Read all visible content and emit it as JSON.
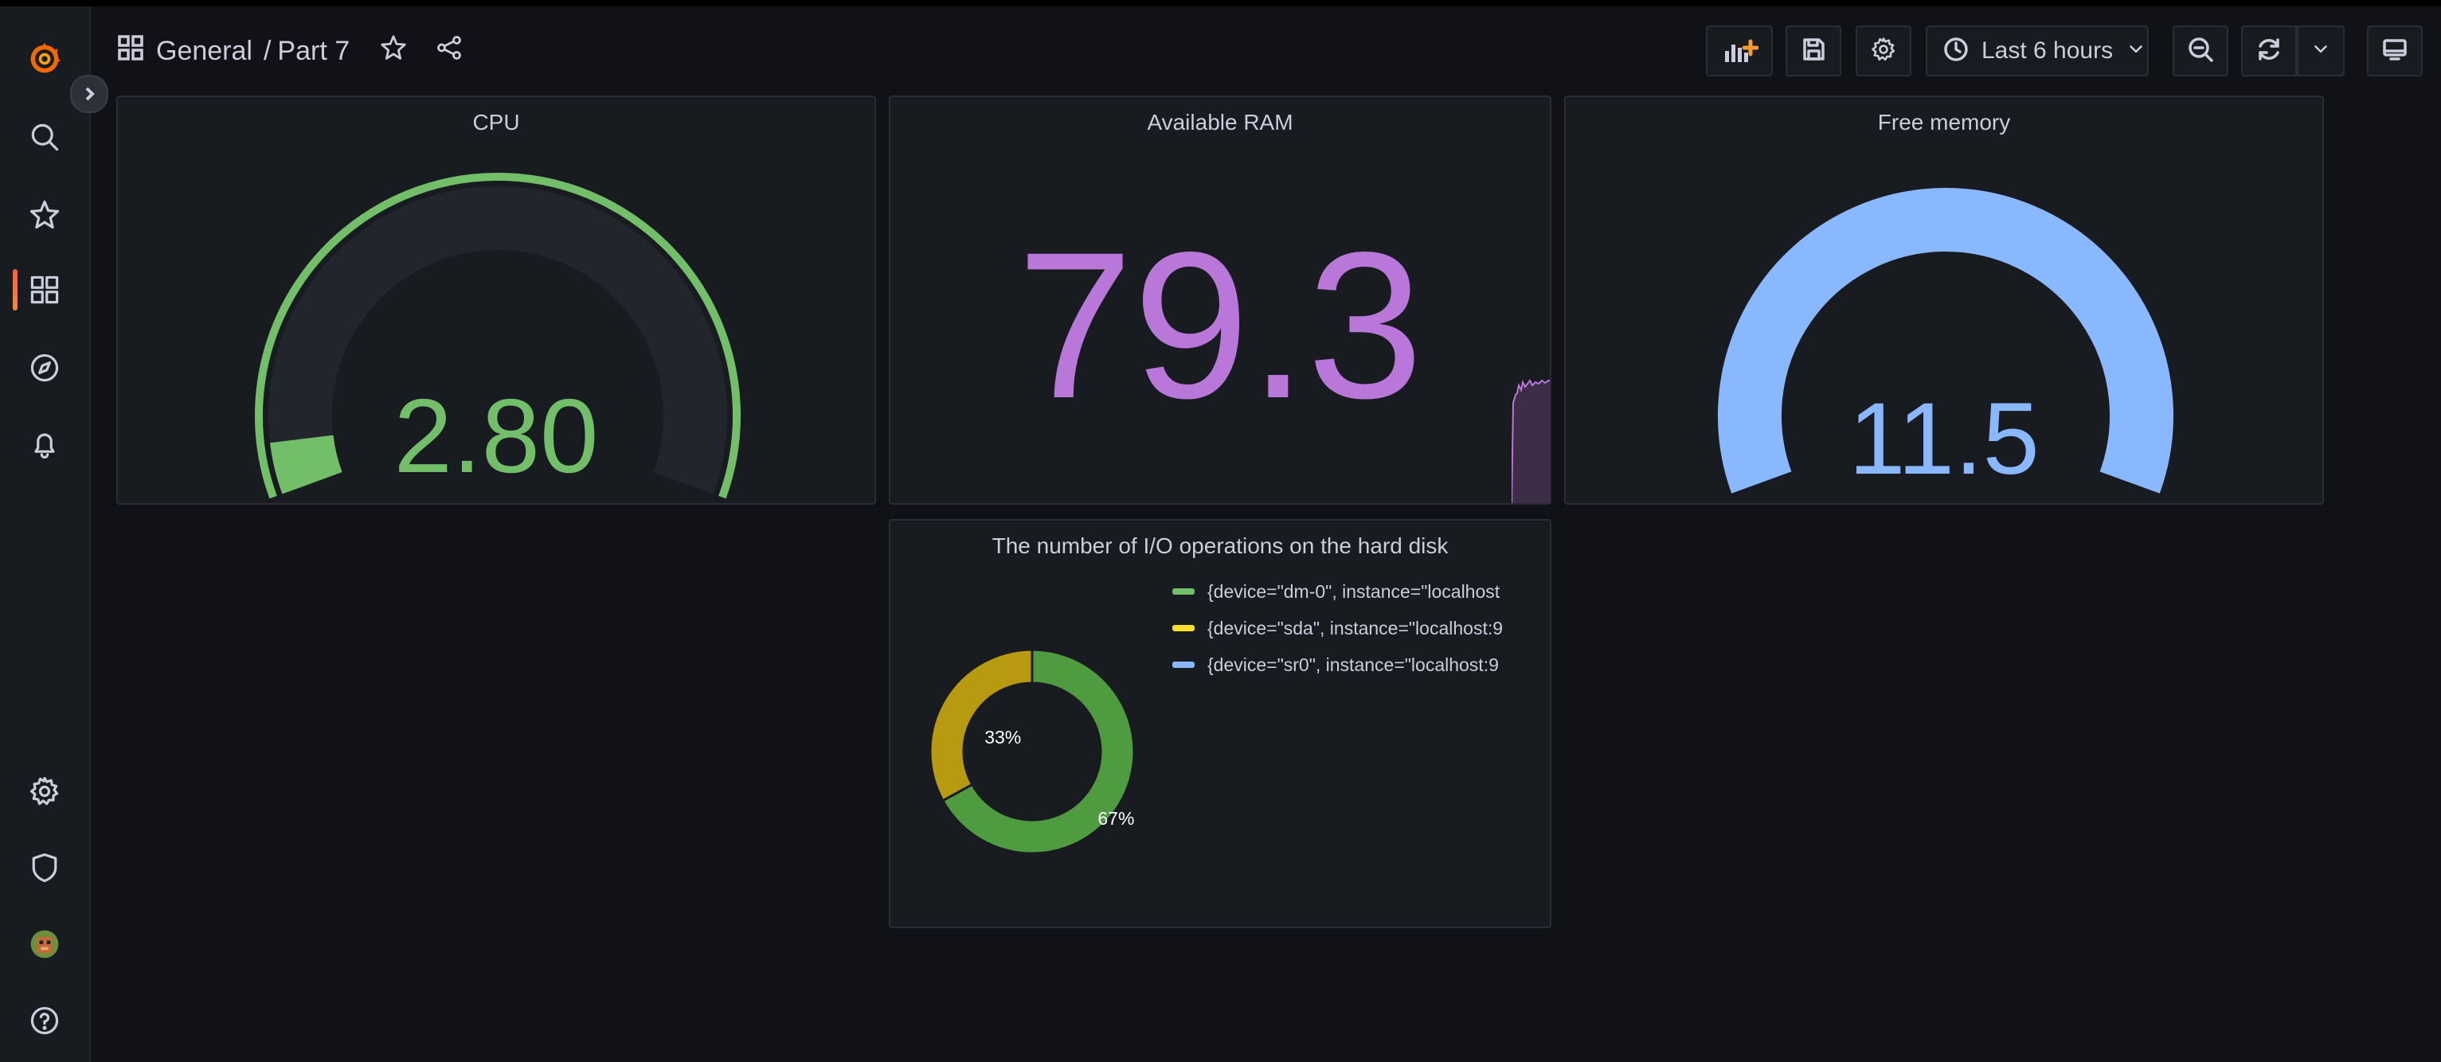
{
  "breadcrumb": {
    "folder": "General",
    "separator": "/",
    "dashboard": "Part 7"
  },
  "toolbar": {
    "time_range": "Last 6 hours"
  },
  "panels": {
    "cpu": {
      "title": "CPU",
      "value": "2.80",
      "color": "#73bf69",
      "gauge_fraction": 0.06
    },
    "ram": {
      "title": "Available RAM",
      "value": "79.3",
      "color": "#b877d9"
    },
    "free": {
      "title": "Free memory",
      "value": "11.5",
      "color": "#8ab8ff",
      "gauge_fraction": 1.0
    },
    "disk": {
      "title": "The number of I/O operations on the hard disk",
      "slice_labels": [
        "67%",
        "33%"
      ],
      "legend": [
        {
          "label": "{device=\"dm-0\", instance=\"localhost",
          "color": "#73bf69"
        },
        {
          "label": "{device=\"sda\", instance=\"localhost:9",
          "color": "#fade2a"
        },
        {
          "label": "{device=\"sr0\", instance=\"localhost:9",
          "color": "#8ab8ff"
        }
      ]
    }
  },
  "chart_data": {
    "type": "pie",
    "title": "The number of I/O operations on the hard disk",
    "categories": [
      "{device=\"dm-0\", instance=\"localhost",
      "{device=\"sda\", instance=\"localhost:9",
      "{device=\"sr0\", instance=\"localhost:9"
    ],
    "values": [
      67,
      33,
      0
    ],
    "colors": [
      "#73bf69",
      "#fade2a",
      "#8ab8ff"
    ],
    "legend": "right"
  }
}
